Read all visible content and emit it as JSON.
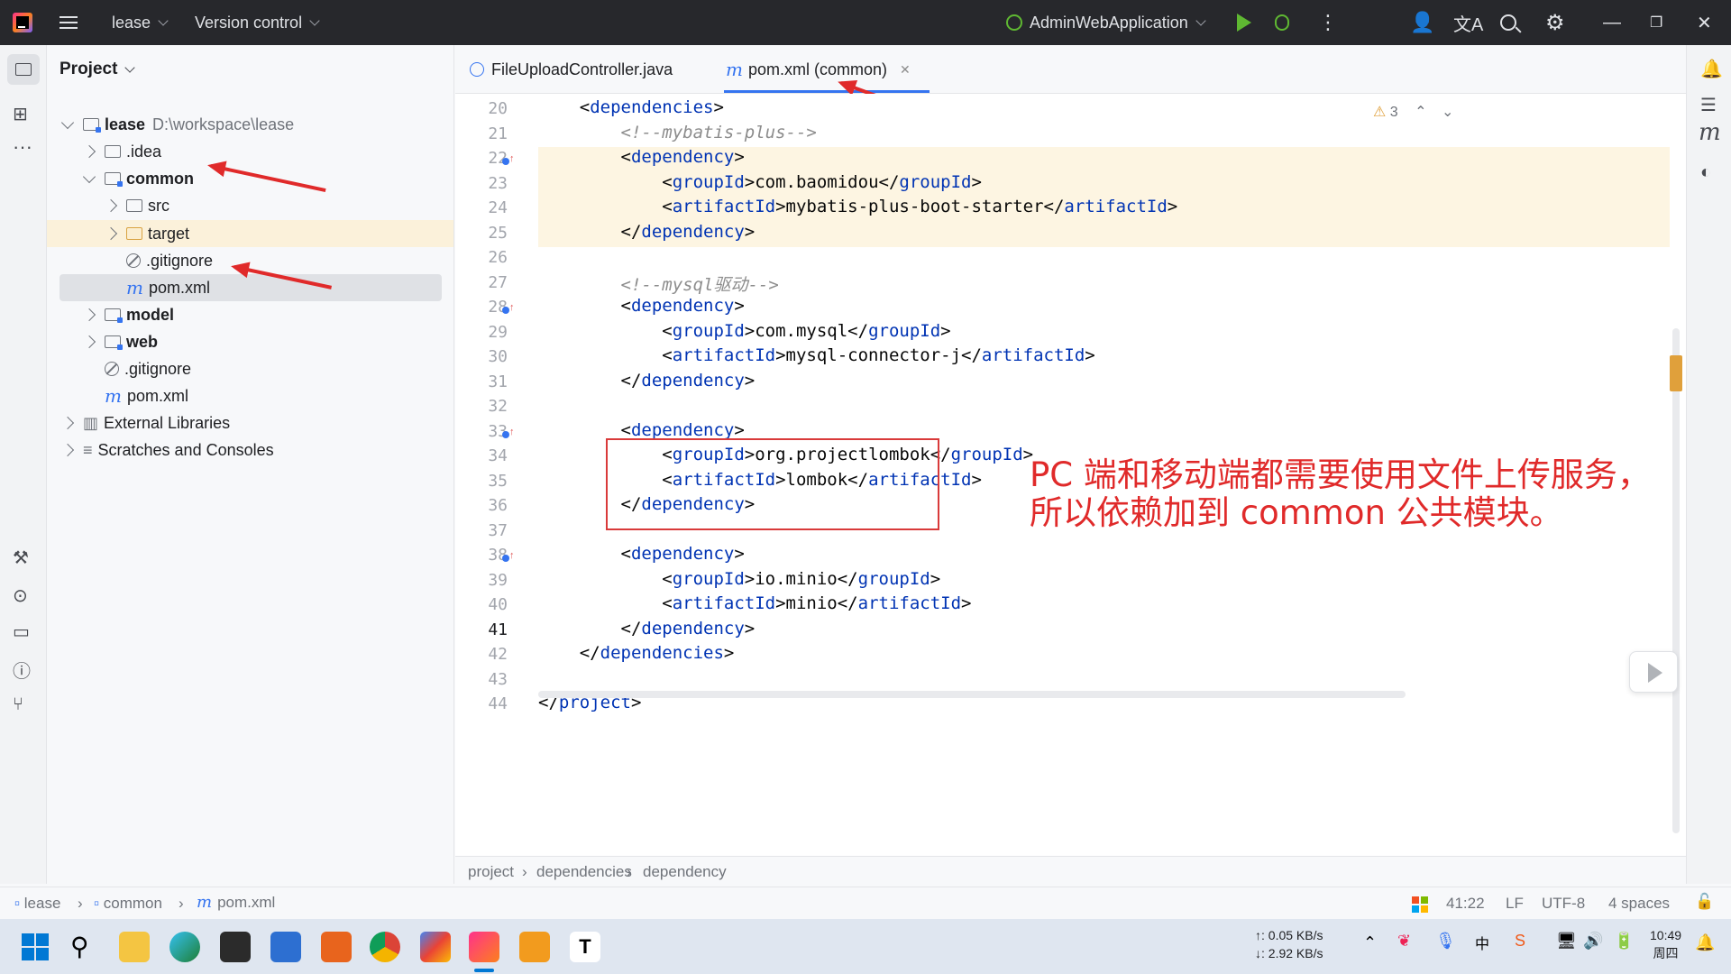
{
  "titlebar": {
    "project_name": "lease",
    "vcs_label": "Version control",
    "run_config": "AdminWebApplication"
  },
  "project_panel": {
    "header": "Project",
    "tree": [
      {
        "label": "lease",
        "extra": "D:\\workspace\\lease",
        "type": "module"
      },
      {
        "label": ".idea",
        "type": "folder"
      },
      {
        "label": "common",
        "type": "module"
      },
      {
        "label": "src",
        "type": "folder"
      },
      {
        "label": "target",
        "type": "excluded-folder"
      },
      {
        "label": ".gitignore",
        "type": "ignore"
      },
      {
        "label": "pom.xml",
        "type": "maven"
      },
      {
        "label": "model",
        "type": "module"
      },
      {
        "label": "web",
        "type": "module"
      },
      {
        "label": ".gitignore",
        "type": "ignore"
      },
      {
        "label": "pom.xml",
        "type": "maven"
      },
      {
        "label": "External Libraries",
        "type": "libraries"
      },
      {
        "label": "Scratches and Consoles",
        "type": "scratches"
      }
    ]
  },
  "tabs": [
    {
      "label": "FileUploadController.java",
      "active": false
    },
    {
      "label": "pom.xml (common)",
      "active": true
    }
  ],
  "editor": {
    "warnings": "3",
    "lines": [
      {
        "n": "20",
        "text": "    <dependencies>"
      },
      {
        "n": "21",
        "text": "        <!--mybatis-plus-->"
      },
      {
        "n": "22",
        "text": "        <dependency>"
      },
      {
        "n": "23",
        "text": "            <groupId>com.baomidou</groupId>"
      },
      {
        "n": "24",
        "text": "            <artifactId>mybatis-plus-boot-starter</artifactId>"
      },
      {
        "n": "25",
        "text": "        </dependency>"
      },
      {
        "n": "26",
        "text": ""
      },
      {
        "n": "27",
        "text": "        <!--mysql驱动-->"
      },
      {
        "n": "28",
        "text": "        <dependency>"
      },
      {
        "n": "29",
        "text": "            <groupId>com.mysql</groupId>"
      },
      {
        "n": "30",
        "text": "            <artifactId>mysql-connector-j</artifactId>"
      },
      {
        "n": "31",
        "text": "        </dependency>"
      },
      {
        "n": "32",
        "text": ""
      },
      {
        "n": "33",
        "text": "        <dependency>"
      },
      {
        "n": "34",
        "text": "            <groupId>org.projectlombok</groupId>"
      },
      {
        "n": "35",
        "text": "            <artifactId>lombok</artifactId>"
      },
      {
        "n": "36",
        "text": "        </dependency>"
      },
      {
        "n": "37",
        "text": ""
      },
      {
        "n": "38",
        "text": "        <dependency>"
      },
      {
        "n": "39",
        "text": "            <groupId>io.minio</groupId>"
      },
      {
        "n": "40",
        "text": "            <artifactId>minio</artifactId>"
      },
      {
        "n": "41",
        "text": "        </dependency>"
      },
      {
        "n": "42",
        "text": "    </dependencies>"
      },
      {
        "n": "43",
        "text": ""
      },
      {
        "n": "44",
        "text": "</project>"
      }
    ]
  },
  "annotation": {
    "line1": "PC 端和移动端都需要使用文件上传服务，",
    "line2": "所以依赖加到 common 公共模块。"
  },
  "breadcrumbs": [
    "project",
    "dependencies",
    "dependency"
  ],
  "statusbar": {
    "path": [
      "lease",
      "common",
      "pom.xml"
    ],
    "position": "41:22",
    "line_sep": "LF",
    "encoding": "UTF-8",
    "indent": "4 spaces"
  },
  "taskbar": {
    "net_up": "↑: 0.05 KB/s",
    "net_down": "↓: 2.92 KB/s",
    "time": "10:49",
    "day": "周四"
  },
  "colors": {
    "titlebar_bg": "#27282c",
    "accent": "#3574f0",
    "xml_tag": "#0033b3",
    "annotation_red": "#e02a2a"
  }
}
